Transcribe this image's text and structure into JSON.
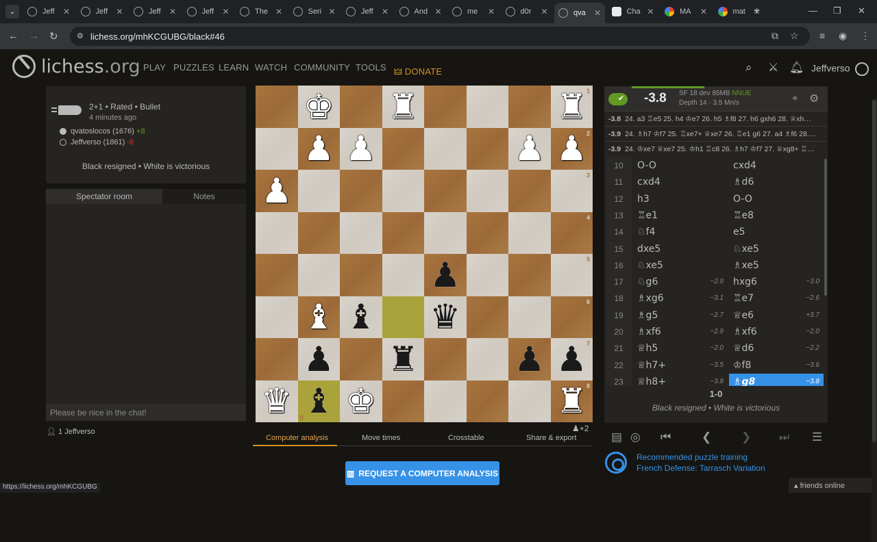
{
  "browser": {
    "tabs": [
      {
        "title": "Jeff"
      },
      {
        "title": "Jeff"
      },
      {
        "title": "Jeff"
      },
      {
        "title": "Jeff"
      },
      {
        "title": "The"
      },
      {
        "title": "Seri"
      },
      {
        "title": "Jeff"
      },
      {
        "title": "And"
      },
      {
        "title": "me"
      },
      {
        "title": "d0r"
      },
      {
        "title": "qva"
      },
      {
        "title": "Cha"
      },
      {
        "title": "MA"
      },
      {
        "title": "mat"
      }
    ],
    "active_tab_index": 10,
    "url": "lichess.org/mhKCGUBG/black#46",
    "status_url": "https://lichess.org/mhKCGUBG"
  },
  "site": {
    "logo_main": "lichess",
    "logo_suffix": ".org",
    "nav": [
      "PLAY",
      "PUZZLES",
      "LEARN",
      "WATCH",
      "COMMUNITY",
      "TOOLS"
    ],
    "donate": "DONATE",
    "username": "Jeffverso"
  },
  "game": {
    "setup": "2+1 • Rated • Bullet",
    "when": "4 minutes ago",
    "white_player": "qvatoslocos (1676)",
    "white_diff": "+8",
    "black_player": "Jeffverso (1861)",
    "black_diff": "-8",
    "result_text": "Black resigned • White is victorious"
  },
  "chat": {
    "tab_room": "Spectator room",
    "tab_notes": "Notes",
    "placeholder": "Please be nice in the chat!",
    "watchers": "1 Jeffverso"
  },
  "board": {
    "orientation": "black",
    "files_shown": [
      "h",
      "g",
      "f",
      "e",
      "d",
      "c",
      "b",
      "a"
    ],
    "ranks_shown": [
      "1",
      "2",
      "3",
      "4",
      "5",
      "6",
      "7",
      "8"
    ],
    "pieces": [
      {
        "sq": "g1",
        "piece": "♚",
        "color": "w"
      },
      {
        "sq": "e1",
        "piece": "♜",
        "color": "w"
      },
      {
        "sq": "a1",
        "piece": "♜",
        "color": "w"
      },
      {
        "sq": "g2",
        "piece": "♟",
        "color": "w"
      },
      {
        "sq": "f2",
        "piece": "♟",
        "color": "w"
      },
      {
        "sq": "b2",
        "piece": "♟",
        "color": "w"
      },
      {
        "sq": "a2",
        "piece": "♟",
        "color": "w"
      },
      {
        "sq": "h3",
        "piece": "♟",
        "color": "w"
      },
      {
        "sq": "d5",
        "piece": "♟",
        "color": "b"
      },
      {
        "sq": "g6",
        "piece": "♝",
        "color": "w"
      },
      {
        "sq": "f6",
        "piece": "♝",
        "color": "b"
      },
      {
        "sq": "d6",
        "piece": "♛",
        "color": "b"
      },
      {
        "sq": "g7",
        "piece": "♟",
        "color": "b"
      },
      {
        "sq": "e7",
        "piece": "♜",
        "color": "b"
      },
      {
        "sq": "b7",
        "piece": "♟",
        "color": "b"
      },
      {
        "sq": "a7",
        "piece": "♟",
        "color": "b"
      },
      {
        "sq": "h8",
        "piece": "♛",
        "color": "w"
      },
      {
        "sq": "g8",
        "piece": "♝",
        "color": "b"
      },
      {
        "sq": "f8",
        "piece": "♚",
        "color": "w"
      },
      {
        "sq": "a8",
        "piece": "♜",
        "color": "w"
      }
    ],
    "highlights": [
      "e6",
      "g8"
    ],
    "material": "+2"
  },
  "under_tabs": [
    "Computer analysis",
    "Move times",
    "Crosstable",
    "Share & export"
  ],
  "request_button": "REQUEST A COMPUTER ANALYSIS",
  "ceval": {
    "score": "-3.8",
    "engine": "SF 18 dev 85MB",
    "nnue": "NNUE",
    "depth": "Depth 14 · 3.5 Mn/s",
    "pvs": [
      {
        "eval": "-3.8",
        "line": "24. a3 ♖e5 25. h4 ♔e7 26. h5 ♗f8 27. h6 gxh6 28. ♕xh…"
      },
      {
        "eval": "-3.9",
        "line": "24. ♗h7 ♔f7 25. ♖xe7+ ♕xe7 26. ♖e1 g6 27. a4 ♗f6 28.…"
      },
      {
        "eval": "-3.9",
        "line": "24. ♔xe7 ♕xe7 25. ♔h1 ♖c8 26. ♗h7 ♔f7 27. ♕xg8+ ♖…"
      }
    ]
  },
  "moves": [
    {
      "n": "10",
      "w": "O-O",
      "we": "",
      "b": "cxd4",
      "be": ""
    },
    {
      "n": "11",
      "w": "cxd4",
      "we": "",
      "b": "♗d6",
      "be": ""
    },
    {
      "n": "12",
      "w": "h3",
      "we": "",
      "b": "O-O",
      "be": ""
    },
    {
      "n": "13",
      "w": "♖e1",
      "we": "",
      "b": "♖e8",
      "be": ""
    },
    {
      "n": "14",
      "w": "♘f4",
      "we": "",
      "b": "e5",
      "be": ""
    },
    {
      "n": "15",
      "w": "dxe5",
      "we": "",
      "b": "♘xe5",
      "be": ""
    },
    {
      "n": "16",
      "w": "♘xe5",
      "we": "",
      "b": "♗xe5",
      "be": ""
    },
    {
      "n": "17",
      "w": "♘g6",
      "we": "−2.9",
      "b": "hxg6",
      "be": "−3.0"
    },
    {
      "n": "18",
      "w": "♗xg6",
      "we": "−3.1",
      "b": "♖e7",
      "be": "−2.6"
    },
    {
      "n": "19",
      "w": "♗g5",
      "we": "−2.7",
      "b": "♕e6",
      "be": "+3.7"
    },
    {
      "n": "20",
      "w": "♗xf6",
      "we": "−2.9",
      "b": "♗xf6",
      "be": "−2.0"
    },
    {
      "n": "21",
      "w": "♕h5",
      "we": "−2.0",
      "b": "♕d6",
      "be": "−2.2"
    },
    {
      "n": "22",
      "w": "♕h7+",
      "we": "−3.5",
      "b": "♔f8",
      "be": "−3.6"
    },
    {
      "n": "23",
      "w": "♕h8+",
      "we": "−3.8",
      "b": "♗g8",
      "be": "−3.8"
    }
  ],
  "final": {
    "score": "1-0",
    "desc": "Black resigned • White is victorious"
  },
  "puzzle": {
    "line1": "Recommended puzzle training",
    "line2": "French Defense: Tarrasch Variation"
  },
  "friends": "friends online",
  "colors": {
    "accent": "#3692e7",
    "green": "#629924",
    "donate": "#d59020"
  }
}
